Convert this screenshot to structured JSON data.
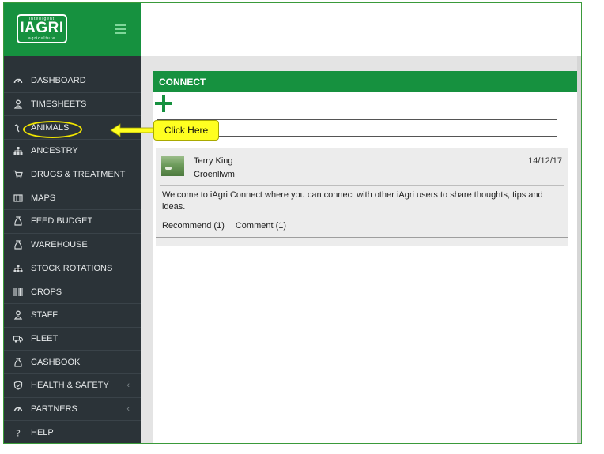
{
  "brand": {
    "tagline_top": "Intelligent",
    "name": "IAGRI",
    "tagline_bottom": "agriculture",
    "logo_color": "#16913f"
  },
  "sidebar": {
    "items": [
      {
        "label": "DASHBOARD",
        "icon": "dashboard-gauge-icon"
      },
      {
        "label": "TIMESHEETS",
        "icon": "person-icon"
      },
      {
        "label": "ANIMALS",
        "icon": "animal-icon"
      },
      {
        "label": "ANCESTRY",
        "icon": "sitemap-icon"
      },
      {
        "label": "DRUGS & TREATMENT",
        "icon": "cart-icon"
      },
      {
        "label": "MAPS",
        "icon": "map-icon"
      },
      {
        "label": "FEED BUDGET",
        "icon": "bag-icon"
      },
      {
        "label": "WAREHOUSE",
        "icon": "bag-icon"
      },
      {
        "label": "STOCK ROTATIONS",
        "icon": "sitemap-icon"
      },
      {
        "label": "CROPS",
        "icon": "barcode-icon"
      },
      {
        "label": "STAFF",
        "icon": "person-icon"
      },
      {
        "label": "FLEET",
        "icon": "truck-icon"
      },
      {
        "label": "CASHBOOK",
        "icon": "bag-icon"
      },
      {
        "label": "HEALTH & SAFETY",
        "icon": "shield-icon"
      },
      {
        "label": "PARTNERS",
        "icon": "dashboard-gauge-icon"
      },
      {
        "label": "HELP",
        "icon": "question-icon"
      }
    ]
  },
  "panel": {
    "title": "CONNECT",
    "input_value": ""
  },
  "post": {
    "author": "Terry King",
    "location": "Croenllwm",
    "date": "14/12/17",
    "message": "Welcome to iAgri Connect where you can connect with other iAgri users to share thoughts, tips and ideas.",
    "recommend_label": "Recommend (1)",
    "comment_label": "Comment (1)"
  },
  "annotation": {
    "label": "Click Here",
    "color": "#ffff21"
  }
}
